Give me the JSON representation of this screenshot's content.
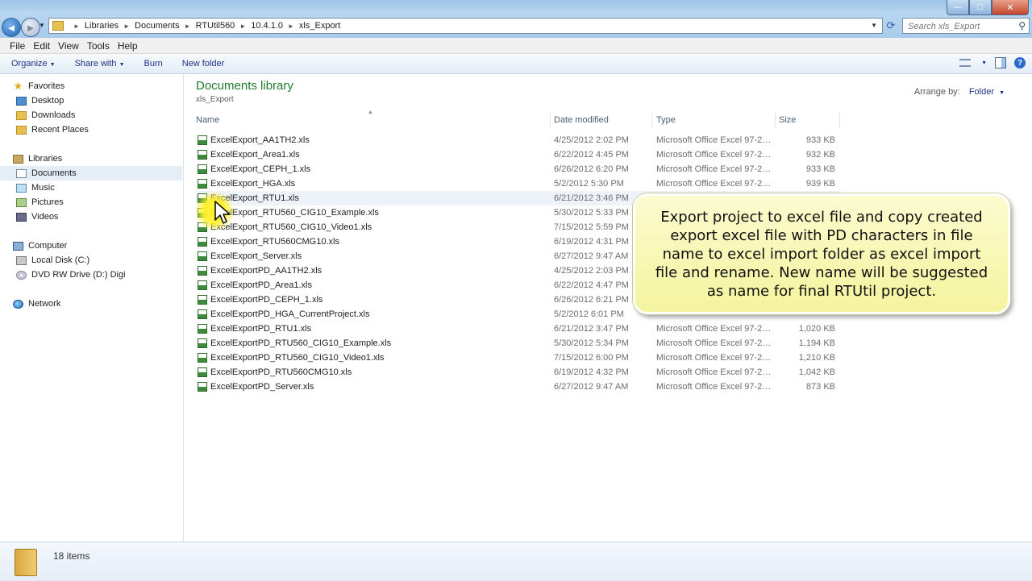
{
  "window": {
    "buttons": [
      "—",
      "□",
      "✕"
    ]
  },
  "address": {
    "crumbs": [
      "Libraries",
      "Documents",
      "RTUtil560",
      "10.4.1.0",
      "xls_Export"
    ]
  },
  "search": {
    "placeholder": "Search xls_Export"
  },
  "menu": {
    "file": "File",
    "edit": "Edit",
    "view": "View",
    "tools": "Tools",
    "help": "Help"
  },
  "toolbar": {
    "organize": "Organize",
    "share_with": "Share with",
    "burn": "Burn",
    "new_folder": "New folder"
  },
  "sidebar": {
    "favorites": "Favorites",
    "desktop": "Desktop",
    "downloads": "Downloads",
    "recent": "Recent Places",
    "libraries": "Libraries",
    "documents": "Documents",
    "music": "Music",
    "pictures": "Pictures",
    "videos": "Videos",
    "computer": "Computer",
    "local_disk": "Local Disk (C:)",
    "dvd": "DVD RW Drive (D:) Digi",
    "network": "Network"
  },
  "library": {
    "title": "Documents library",
    "subtitle": "xls_Export",
    "arrange_label": "Arrange by:",
    "arrange_value": "Folder"
  },
  "columns": {
    "name": "Name",
    "date": "Date modified",
    "type": "Type",
    "size": "Size"
  },
  "files": [
    {
      "name": "ExcelExport_AA1TH2.xls",
      "date": "4/25/2012 2:02 PM",
      "type": "Microsoft Office Excel 97-2003...",
      "size": "933 KB"
    },
    {
      "name": "ExcelExport_Area1.xls",
      "date": "6/22/2012 4:45 PM",
      "type": "Microsoft Office Excel 97-2003...",
      "size": "932 KB"
    },
    {
      "name": "ExcelExport_CEPH_1.xls",
      "date": "6/26/2012 6:20 PM",
      "type": "Microsoft Office Excel 97-2003...",
      "size": "933 KB"
    },
    {
      "name": "ExcelExport_HGA.xls",
      "date": "5/2/2012 5:30 PM",
      "type": "Microsoft Office Excel 97-2003...",
      "size": "939 KB"
    },
    {
      "name": "ExcelExport_RTU1.xls",
      "date": "6/21/2012 3:46 PM",
      "type": "",
      "size": ""
    },
    {
      "name": "ExcelExport_RTU560_CIG10_Example.xls",
      "date": "5/30/2012 5:33 PM",
      "type": "",
      "size": ""
    },
    {
      "name": "ExcelExport_RTU560_CIG10_Video1.xls",
      "date": "7/15/2012 5:59 PM",
      "type": "",
      "size": ""
    },
    {
      "name": "ExcelExport_RTU560CMG10.xls",
      "date": "6/19/2012 4:31 PM",
      "type": "",
      "size": ""
    },
    {
      "name": "ExcelExport_Server.xls",
      "date": "6/27/2012 9:47 AM",
      "type": "",
      "size": ""
    },
    {
      "name": "ExcelExportPD_AA1TH2.xls",
      "date": "4/25/2012 2:03 PM",
      "type": "",
      "size": ""
    },
    {
      "name": "ExcelExportPD_Area1.xls",
      "date": "6/22/2012 4:47 PM",
      "type": "",
      "size": ""
    },
    {
      "name": "ExcelExportPD_CEPH_1.xls",
      "date": "6/26/2012 6:21 PM",
      "type": "",
      "size": ""
    },
    {
      "name": "ExcelExportPD_HGA_CurrentProject.xls",
      "date": "5/2/2012 6:01 PM",
      "type": "",
      "size": ""
    },
    {
      "name": "ExcelExportPD_RTU1.xls",
      "date": "6/21/2012 3:47 PM",
      "type": "Microsoft Office Excel 97-2003...",
      "size": "1,020 KB"
    },
    {
      "name": "ExcelExportPD_RTU560_CIG10_Example.xls",
      "date": "5/30/2012 5:34 PM",
      "type": "Microsoft Office Excel 97-2003...",
      "size": "1,194 KB"
    },
    {
      "name": "ExcelExportPD_RTU560_CIG10_Video1.xls",
      "date": "7/15/2012 6:00 PM",
      "type": "Microsoft Office Excel 97-2003...",
      "size": "1,210 KB"
    },
    {
      "name": "ExcelExportPD_RTU560CMG10.xls",
      "date": "6/19/2012 4:32 PM",
      "type": "Microsoft Office Excel 97-2003...",
      "size": "1,042 KB"
    },
    {
      "name": "ExcelExportPD_Server.xls",
      "date": "6/27/2012 9:47 AM",
      "type": "Microsoft Office Excel 97-2003...",
      "size": "873 KB"
    }
  ],
  "callout": {
    "text": "Export project to excel file and copy created export excel file with PD characters in file name to excel import folder as excel import file and rename. New name will be suggested as name for final RTUtil project."
  },
  "status": {
    "count": "18 items"
  }
}
